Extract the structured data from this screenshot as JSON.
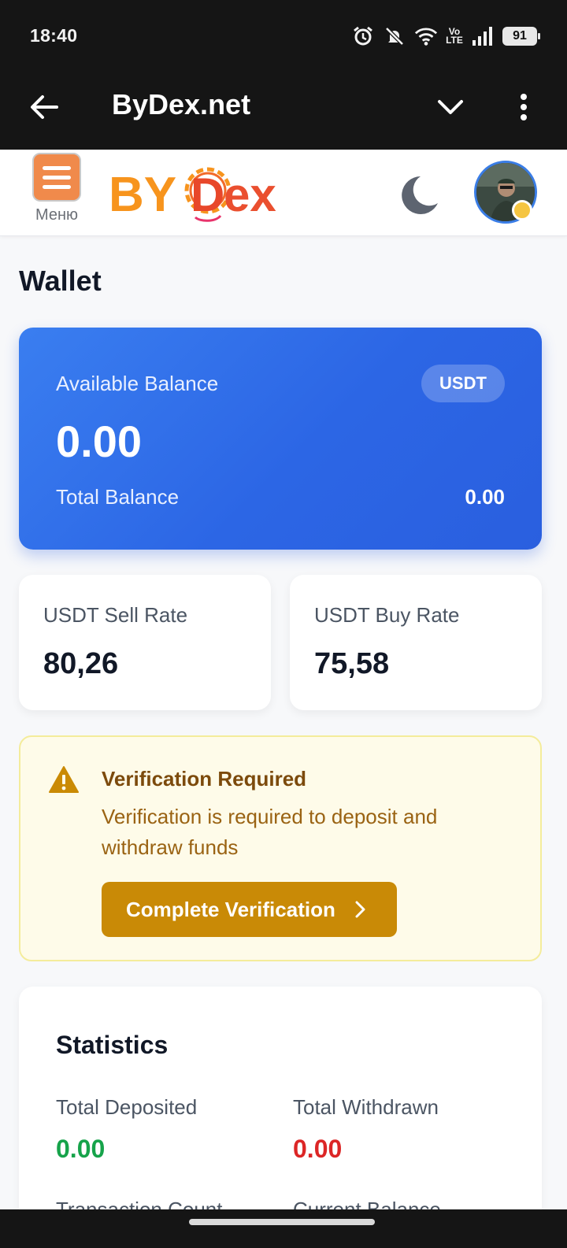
{
  "status_bar": {
    "time": "18:40",
    "network": "Vo LTE",
    "battery": "91"
  },
  "browser": {
    "title": "ByDex.net"
  },
  "header": {
    "menu_label": "Меню",
    "logo_text_left": "BY",
    "logo_text_right": "ex",
    "logo_letter": "D",
    "colors": {
      "logo_orange": "#f7941d",
      "logo_red": "#e8472a",
      "menu_bg": "#f08a4b"
    }
  },
  "page": {
    "title": "Wallet"
  },
  "balance": {
    "label": "Available Balance",
    "currency": "USDT",
    "amount": "0.00",
    "total_label": "Total Balance",
    "total_value": "0.00"
  },
  "rates": [
    {
      "label": "USDT Sell Rate",
      "value": "80,26"
    },
    {
      "label": "USDT Buy Rate",
      "value": "75,58"
    }
  ],
  "verification": {
    "title": "Verification Required",
    "text": "Verification is required to deposit and withdraw funds",
    "button_label": "Complete Verification"
  },
  "statistics": {
    "title": "Statistics",
    "items": [
      {
        "label": "Total Deposited",
        "value": "0.00"
      },
      {
        "label": "Total Withdrawn",
        "value": "0.00"
      },
      {
        "label": "Transaction Count"
      },
      {
        "label": "Current Balance"
      }
    ]
  }
}
